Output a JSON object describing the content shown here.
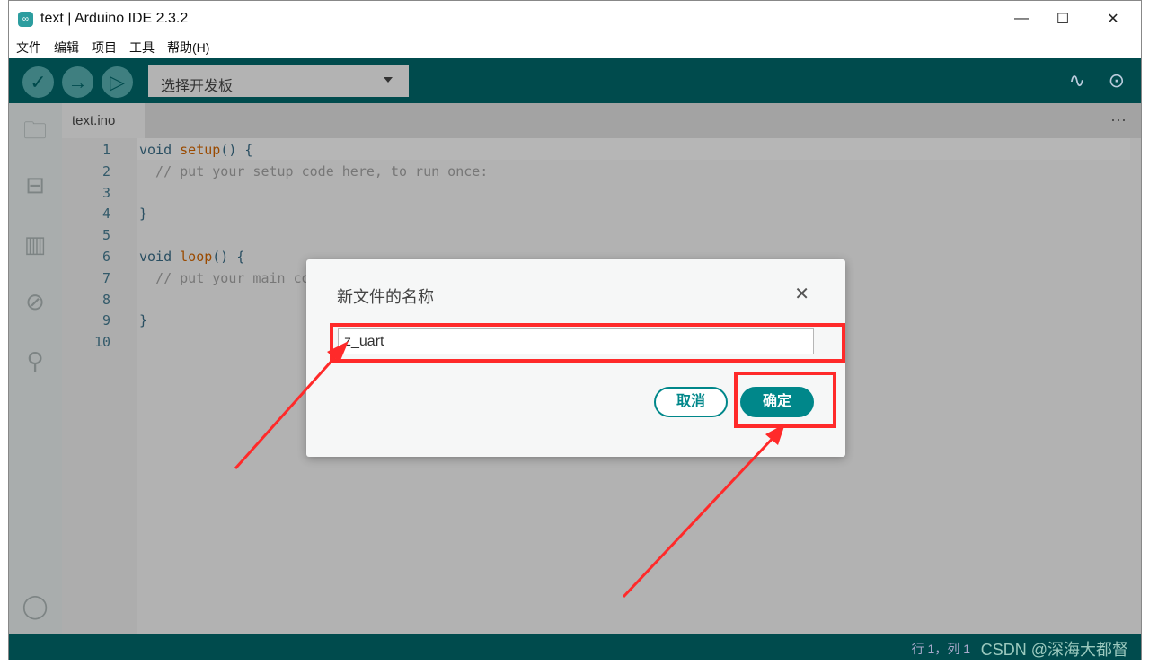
{
  "window": {
    "title": "text | Arduino IDE 2.3.2",
    "minimize": "—",
    "maximize": "☐",
    "close": "✕"
  },
  "menu": [
    "文件",
    "编辑",
    "项目",
    "工具",
    "帮助(H)"
  ],
  "toolbar": {
    "board_select": "选择开发板"
  },
  "tab": {
    "name": "text.ino",
    "more": "···"
  },
  "code": [
    {
      "n": "1",
      "parts": [
        [
          "kw",
          "void "
        ],
        [
          "fn",
          "setup"
        ],
        [
          "kw",
          "() {"
        ]
      ]
    },
    {
      "n": "2",
      "parts": [
        [
          "cm",
          "  // put your setup code here, to run once:"
        ]
      ]
    },
    {
      "n": "3",
      "parts": []
    },
    {
      "n": "4",
      "parts": [
        [
          "kw",
          "}"
        ]
      ]
    },
    {
      "n": "5",
      "parts": []
    },
    {
      "n": "6",
      "parts": [
        [
          "kw",
          "void "
        ],
        [
          "fn",
          "loop"
        ],
        [
          "kw",
          "() {"
        ]
      ]
    },
    {
      "n": "7",
      "parts": [
        [
          "cm",
          "  // put your main code here, to run repeatedly:"
        ]
      ]
    },
    {
      "n": "8",
      "parts": []
    },
    {
      "n": "9",
      "parts": [
        [
          "kw",
          "}"
        ]
      ]
    },
    {
      "n": "10",
      "parts": []
    }
  ],
  "status": {
    "position": "行 1，列 1",
    "watermark": "CSDN @深海大都督"
  },
  "dialog": {
    "title": "新文件的名称",
    "input_value": "z_uart",
    "cancel": "取消",
    "ok": "确定"
  },
  "colors": {
    "toolbar": "#004b4d",
    "accent": "#00878a",
    "annotation": "#ff2a2a"
  }
}
